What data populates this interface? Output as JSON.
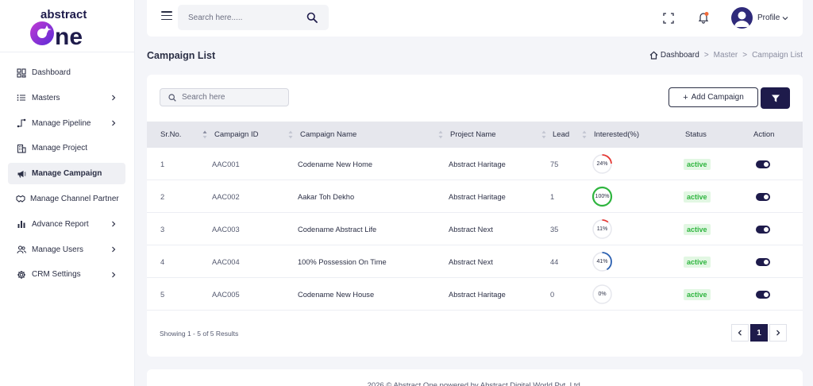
{
  "brand": {
    "line1": "abstract",
    "line2": "One"
  },
  "sidebar": {
    "items": [
      {
        "label": "Dashboard",
        "icon": "grid-icon",
        "chevron": false,
        "active": false
      },
      {
        "label": "Masters",
        "icon": "list-icon",
        "chevron": true,
        "active": false
      },
      {
        "label": "Manage Pipeline",
        "icon": "pipeline-icon",
        "chevron": true,
        "active": false
      },
      {
        "label": "Manage Project",
        "icon": "building-icon",
        "chevron": false,
        "active": false
      },
      {
        "label": "Manage Campaign",
        "icon": "megaphone-icon",
        "chevron": false,
        "active": true
      },
      {
        "label": "Manage Channel Partner",
        "icon": "handshake-icon",
        "chevron": false,
        "active": false
      },
      {
        "label": "Advance Report",
        "icon": "bar-chart-icon",
        "chevron": true,
        "active": false
      },
      {
        "label": "Manage Users",
        "icon": "users-icon",
        "chevron": true,
        "active": false
      },
      {
        "label": "CRM Settings",
        "icon": "gear-icon",
        "chevron": true,
        "active": false
      }
    ]
  },
  "header": {
    "search_placeholder": "Search here.....",
    "profile_label": "Profile"
  },
  "page": {
    "title": "Campaign List",
    "breadcrumb": [
      "Dashboard",
      "Master",
      "Campaign List"
    ]
  },
  "toolbar": {
    "search_placeholder": "Search here",
    "add_label": "Add Campaign"
  },
  "table": {
    "columns": [
      "Sr.No.",
      "Campaign ID",
      "Campaign Name",
      "Project Name",
      "Lead",
      "Interested(%)",
      "Status",
      "Action"
    ],
    "rows": [
      {
        "sr": "1",
        "id": "AAC001",
        "name": "Codename New Home",
        "project": "Abstract Haritage",
        "lead": "75",
        "interested": "24%",
        "pct": 24,
        "status": "active"
      },
      {
        "sr": "2",
        "id": "AAC002",
        "name": "Aakar Toh Dekho",
        "project": "Abstract Haritage",
        "lead": "1",
        "interested": "100%",
        "pct": 100,
        "status": "active"
      },
      {
        "sr": "3",
        "id": "AAC003",
        "name": "Codename Abstract Life",
        "project": "Abstract Next",
        "lead": "35",
        "interested": "11%",
        "pct": 11,
        "status": "active"
      },
      {
        "sr": "4",
        "id": "AAC004",
        "name": "100% Possession On Time",
        "project": "Abstract Next",
        "lead": "44",
        "interested": "41%",
        "pct": 41,
        "status": "active"
      },
      {
        "sr": "5",
        "id": "AAC005",
        "name": "Codename New House",
        "project": "Abstract Haritage",
        "lead": "0",
        "interested": "0%",
        "pct": 0,
        "status": "active"
      }
    ]
  },
  "pagination": {
    "summary": "Showing 1 - 5 of 5 Results",
    "current": "1"
  },
  "footer": {
    "text": "2026 © Abstract One powered by Abstract Digital World Pvt. Ltd."
  },
  "colors": {
    "primary": "#1e1b4b",
    "active_badge_bg": "#e2f7e3",
    "active_badge_text": "#2fb53f",
    "ring_low": "#e53935",
    "ring_full": "#2fb53f",
    "ring_mid": "#2a5fb0"
  }
}
